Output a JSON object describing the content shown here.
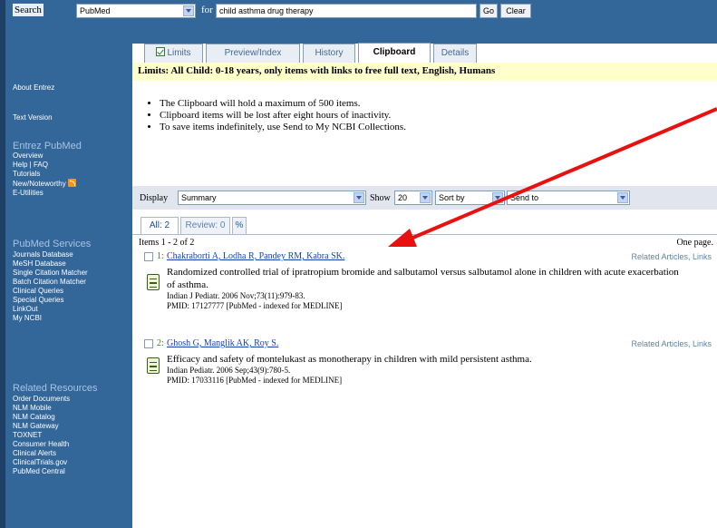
{
  "search": {
    "label": "Search",
    "database": "PubMed",
    "for_label": "for",
    "query": "child asthma drug therapy",
    "go_label": "Go",
    "clear_label": "Clear"
  },
  "tabs": [
    {
      "label": "Limits"
    },
    {
      "label": "Preview/Index"
    },
    {
      "label": "History"
    },
    {
      "label": "Clipboard"
    },
    {
      "label": "Details"
    }
  ],
  "limits_text": "Limits: All Child: 0-18 years, only items with links to free full text, English, Humans",
  "notes": [
    "The Clipboard will hold a maximum of 500 items.",
    "Clipboard items will be lost after eight hours of inactivity.",
    "To save items indefinitely, use Send to My NCBI Collections."
  ],
  "sidebar": {
    "top_links": [
      "About Entrez",
      "Text Version"
    ],
    "entrez_pubmed": {
      "heading": "Entrez PubMed",
      "links": [
        "Overview",
        "Help | FAQ",
        "Tutorials",
        "New/Noteworthy",
        "E-Utilities"
      ]
    },
    "pubmed_services": {
      "heading": "PubMed Services",
      "links": [
        "Journals Database",
        "MeSH Database",
        "Single Citation Matcher",
        "Batch Citation Matcher",
        "Clinical Queries",
        "Special Queries",
        "LinkOut",
        "My NCBI"
      ]
    },
    "related_resources": {
      "heading": "Related Resources",
      "links": [
        "Order Documents",
        "NLM Mobile",
        "NLM Catalog",
        "NLM Gateway",
        "TOXNET",
        "Consumer Health",
        "Clinical Alerts",
        "ClinicalTrials.gov",
        "PubMed Central"
      ]
    }
  },
  "display_bar": {
    "display_label": "Display",
    "display_value": "Summary",
    "show_label": "Show",
    "show_value": "20",
    "sort_value": "Sort by",
    "send_value": "Send to"
  },
  "sub_tabs": {
    "all": "All: 2",
    "review": "Review: 0"
  },
  "items_count": "Items 1 - 2 of 2",
  "one_page": "One page.",
  "results": [
    {
      "num": "1:",
      "authors": "Chakraborti A, Lodha R, Pandey RM, Kabra SK.",
      "related": "Related Articles, Links",
      "title": "Randomized controlled trial of ipratropium bromide and salbutamol versus salbutamol alone in children with acute exacerbation of asthma.",
      "journal": "Indian J Pediatr. 2006 Nov;73(11):979-83.",
      "pmid": "PMID: 17127777 [PubMed - indexed for MEDLINE]"
    },
    {
      "num": "2:",
      "authors": "Ghosh G, Manglik AK, Roy S.",
      "related": "Related Articles, Links",
      "title": "Efficacy and safety of montelukast as monotherapy in children with mild persistent asthma.",
      "journal": "Indian Pediatr. 2006 Sep;43(9):780-5.",
      "pmid": "PMID: 17033116 [PubMed - indexed for MEDLINE]"
    }
  ],
  "colors": {
    "sidebar_bg": "#336699",
    "limits_bg": "#ffffcc",
    "link": "#1a40b0",
    "arrow": "#e8110f"
  },
  "icons": [
    "rss-icon",
    "checkbox-icon",
    "document-icon",
    "dropdown-arrow-icon",
    "annotation-arrow"
  ]
}
